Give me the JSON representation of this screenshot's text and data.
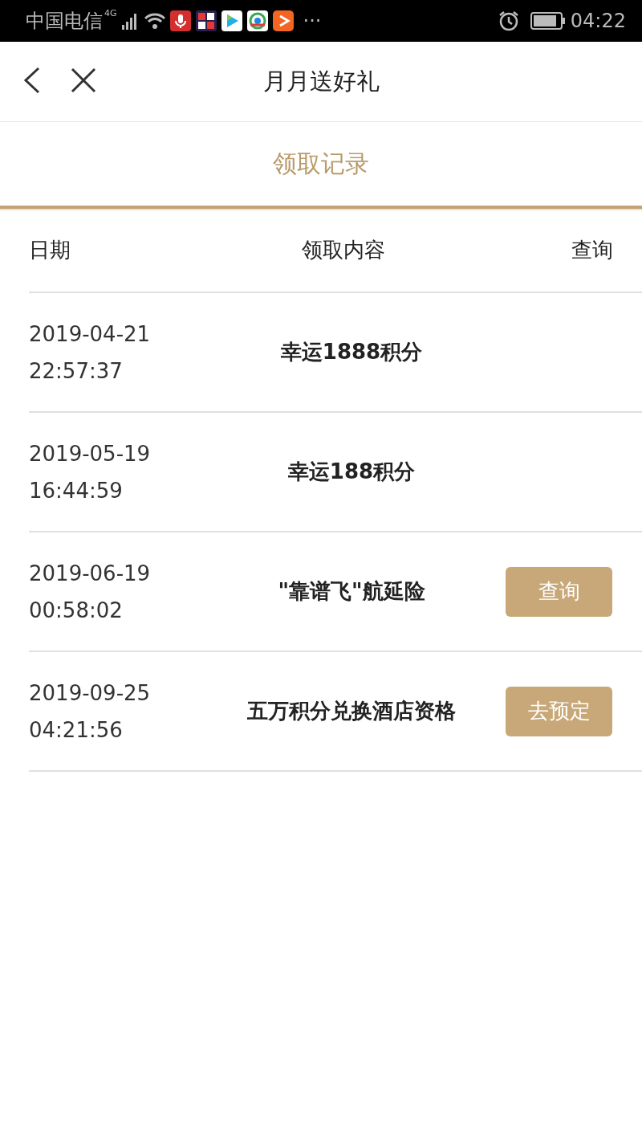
{
  "status_bar": {
    "carrier": "中国电信",
    "network": "4G",
    "more": "···",
    "time": "04:22"
  },
  "nav": {
    "title": "月月送好礼"
  },
  "section": {
    "title": "领取记录"
  },
  "table": {
    "columns": [
      "日期",
      "领取内容",
      "查询"
    ],
    "rows": [
      {
        "date": "2019-04-21",
        "time": "22:57:37",
        "content": "幸运1888积分"
      },
      {
        "date": "2019-05-19",
        "time": "16:44:59",
        "content": "幸运188积分"
      },
      {
        "date": "2019-06-19",
        "time": "00:58:02",
        "content": "\"靠谱飞\"航延险",
        "action": "查询"
      },
      {
        "date": "2019-09-25",
        "time": "04:21:56",
        "content": "五万积分兑换酒店资格",
        "action": "去预定"
      }
    ]
  }
}
